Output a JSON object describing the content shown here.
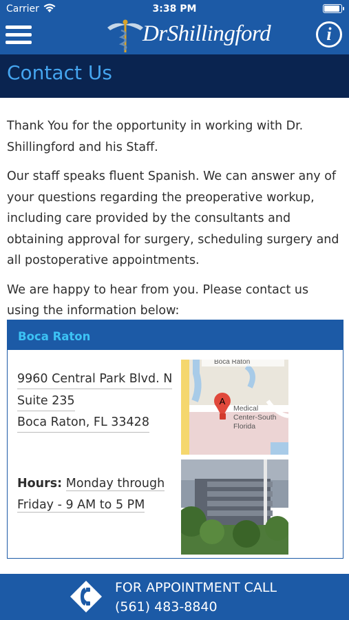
{
  "status_bar": {
    "carrier": "Carrier",
    "time": "3:38 PM"
  },
  "header": {
    "logo_text": "DrShillingford",
    "menu_icon": "hamburger-menu-icon",
    "info_icon": "info-icon",
    "info_glyph": "i"
  },
  "page": {
    "title": "Contact Us"
  },
  "intro": {
    "paragraphs": [
      "Thank You for the opportunity in working with Dr. Shillingford and his Staff.",
      "Our staff speaks fluent Spanish. We can answer any of your questions regarding the preoperative workup, including care provided by the consultants and obtaining approval for surgery, scheduling surgery and all postoperative appointments.",
      "We are happy to hear from you. Please contact us using the information below:"
    ]
  },
  "location": {
    "name": "Boca Raton",
    "address_lines": [
      "9960 Central Park Blvd. N",
      "Suite 235",
      "Boca Raton, FL 33428"
    ],
    "hours_label": "Hours:",
    "hours_value": "Monday through Friday - 9 AM to 5 PM",
    "map": {
      "city_label": "Boca Raton",
      "marker_letter": "A",
      "place_label_1": "Medical",
      "place_label_2": "Center-South",
      "place_label_3": "Florida"
    }
  },
  "call_bar": {
    "label": "FOR APPOINTMENT CALL",
    "number": "(561) 483-8840",
    "icon": "phone-icon"
  },
  "colors": {
    "header_blue": "#1c5aa6",
    "title_bar": "#0a2450",
    "title_text": "#45a5ef",
    "card_title": "#3cc3f5"
  }
}
